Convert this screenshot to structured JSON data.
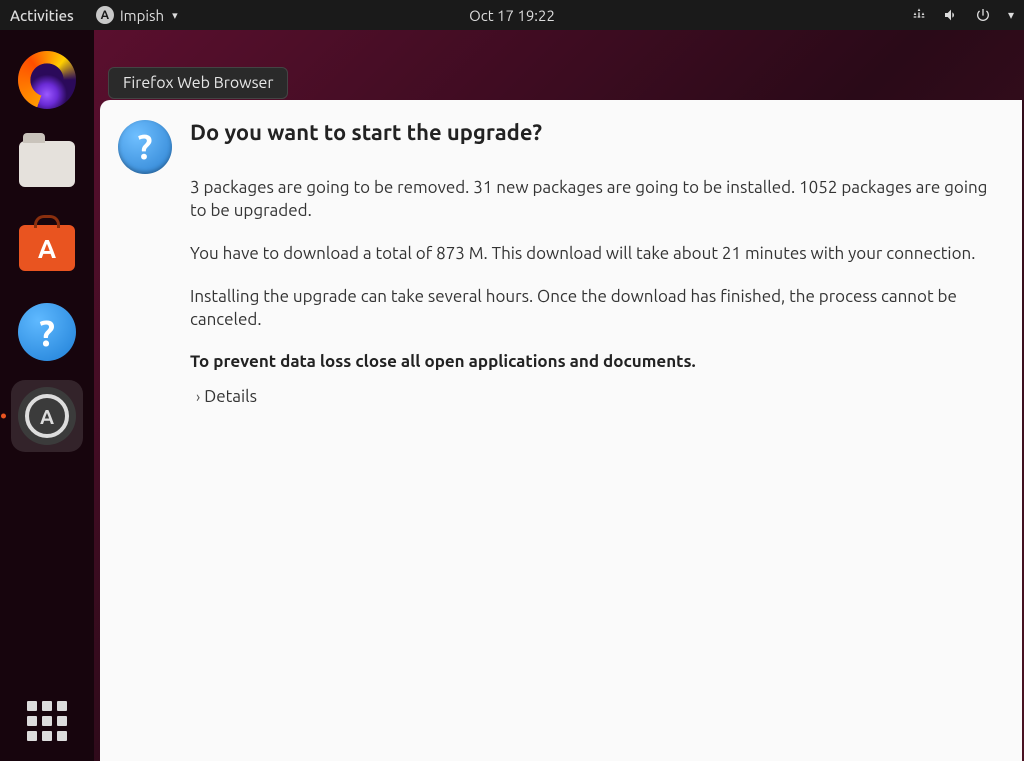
{
  "topbar": {
    "activities": "Activities",
    "app_name": "Impish",
    "clock": "Oct 17  19:22"
  },
  "tooltip": {
    "firefox": "Firefox Web Browser"
  },
  "dialog": {
    "title": "Do you want to start the upgrade?",
    "p1": "3 packages are going to be removed. 31 new packages are going to be installed. 1052 packages are going to be upgraded.",
    "p2": "You have to download a total of 873 M. This download will take about 21 minutes with your connection.",
    "p3": "Installing the upgrade can take several hours. Once the download has finished, the process cannot be canceled.",
    "warning": "To prevent data loss close all open applications and documents.",
    "details_label": "Details"
  }
}
